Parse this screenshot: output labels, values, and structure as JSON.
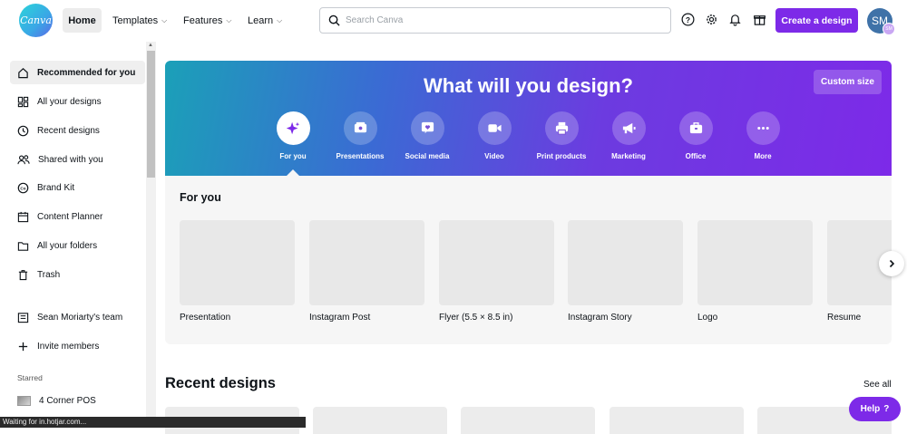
{
  "app": {
    "logo_text": "Canva"
  },
  "nav": {
    "home": "Home",
    "templates": "Templates",
    "features": "Features",
    "learn": "Learn"
  },
  "search": {
    "placeholder": "Search Canva"
  },
  "toolbar": {
    "create_label": "Create a design"
  },
  "user": {
    "initials": "SM",
    "badge": "SM"
  },
  "sidebar": {
    "items": [
      {
        "label": "Recommended for you",
        "icon": "home-icon"
      },
      {
        "label": "All your designs",
        "icon": "grid-icon"
      },
      {
        "label": "Recent designs",
        "icon": "clock-icon"
      },
      {
        "label": "Shared with you",
        "icon": "people-icon"
      },
      {
        "label": "Brand Kit",
        "icon": "brand-kit-icon"
      },
      {
        "label": "Content Planner",
        "icon": "calendar-icon"
      },
      {
        "label": "All your folders",
        "icon": "folder-icon"
      },
      {
        "label": "Trash",
        "icon": "trash-icon"
      },
      {
        "label": "Sean Moriarty's team",
        "icon": "team-icon"
      },
      {
        "label": "Invite members",
        "icon": "plus-icon"
      }
    ],
    "starred_heading": "Starred",
    "starred_items": [
      {
        "label": "4 Corner POS"
      }
    ]
  },
  "hero": {
    "title": "What will you design?",
    "custom_size": "Custom size",
    "categories": [
      {
        "label": "For you",
        "icon": "sparkle-icon"
      },
      {
        "label": "Presentations",
        "icon": "presentation-icon"
      },
      {
        "label": "Social media",
        "icon": "heart-icon"
      },
      {
        "label": "Video",
        "icon": "video-icon"
      },
      {
        "label": "Print products",
        "icon": "printer-icon"
      },
      {
        "label": "Marketing",
        "icon": "megaphone-icon"
      },
      {
        "label": "Office",
        "icon": "briefcase-icon"
      },
      {
        "label": "More",
        "icon": "more-icon"
      }
    ]
  },
  "for_you": {
    "title": "For you",
    "templates": [
      {
        "label": "Presentation"
      },
      {
        "label": "Instagram Post"
      },
      {
        "label": "Flyer (5.5 × 8.5 in)"
      },
      {
        "label": "Instagram Story"
      },
      {
        "label": "Logo"
      },
      {
        "label": "Resume"
      }
    ]
  },
  "recent": {
    "title": "Recent designs",
    "see_all": "See all"
  },
  "help": {
    "label": "Help",
    "symbol": "?"
  },
  "status_bar": {
    "text": "Waiting for in.hotjar.com..."
  },
  "colors": {
    "accent": "#7d2ae8",
    "hero_start": "#1ba0b8",
    "hero_end": "#7d2ae8"
  }
}
